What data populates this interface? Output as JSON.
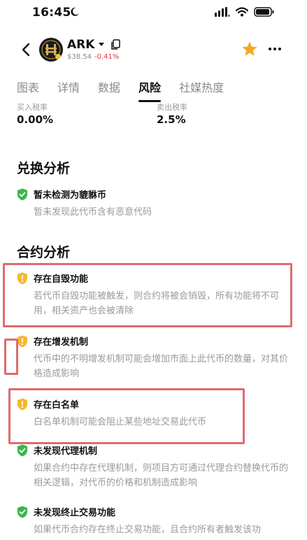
{
  "status": {
    "time": "16:45"
  },
  "token": {
    "name": "ARK",
    "price": "$38.54",
    "change": "-0.41%"
  },
  "tabs": [
    {
      "label": "图表"
    },
    {
      "label": "详情"
    },
    {
      "label": "数据"
    },
    {
      "label": "风险",
      "active": true
    },
    {
      "label": "社媒热度"
    }
  ],
  "tax": {
    "buy_label": "买入税率",
    "buy_value": "0.00%",
    "sell_label": "卖出税率",
    "sell_value": "2.5%"
  },
  "swap": {
    "title": "兑换分析",
    "items": [
      {
        "title": "暂未检测为貔貅币",
        "desc": "暂未发现此代币含有恶意代码",
        "level": "safe"
      }
    ]
  },
  "contract": {
    "title": "合约分析",
    "items": [
      {
        "title": "存在自毁功能",
        "desc": "若代币自毁功能被触发，则合约将被会销毁，所有功能将不可用，相关资产也会被清除",
        "level": "warn"
      },
      {
        "title": "存在增发机制",
        "desc": "代币中的不明增发机制可能会增加市面上此代币的数量，对其价格造成影响",
        "level": "warn"
      },
      {
        "title": "存在白名单",
        "desc": "白名单机制可能会阻止某些地址交易此代币",
        "level": "warn"
      },
      {
        "title": "未发现代理机制",
        "desc": "如果合约中存在代理机制，则项目方可通过代理合约替换代币的相关逻辑，对代币的价格和机制造成影响",
        "level": "safe"
      },
      {
        "title": "未发现终止交易功能",
        "desc": "如果代币合约存在终止交易功能，且合约所有者触发该功",
        "level": "safe"
      }
    ]
  },
  "colors": {
    "safe": "#3cb54a",
    "warn": "#f5b82e",
    "highlight": "#e06b6b",
    "change": "#e0393e"
  }
}
